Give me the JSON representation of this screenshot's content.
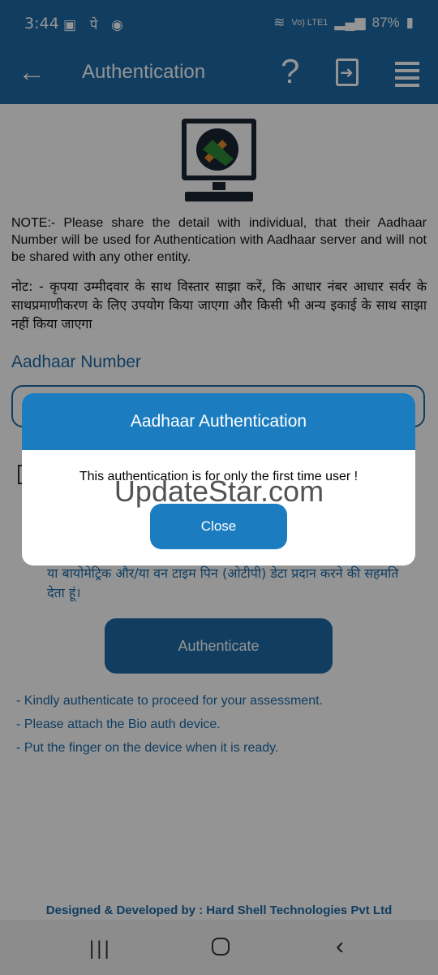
{
  "status_bar": {
    "time": "3:44",
    "left_icons": "▣ पे ◉",
    "network": "Vo) LTE1",
    "battery": "87%"
  },
  "app_bar": {
    "title": "Authentication"
  },
  "note_en": "NOTE:- Please share the detail with individual, that their Aadhaar Number will be used for Authentication with Aadhaar server and will not be shared with any other entity.",
  "note_hi": "नोट: - कृपया उम्मीदवार के साथ विस्तार साझा करें, कि आधार नंबर आधार सर्वर के साथप्रमाणीकरण के लिए उपयोग किया जाएगा और किसी भी अन्य इकाई के साथ साझा नहीं किया जाएगा",
  "aadhaar": {
    "label": "Aadhaar Number",
    "value": ""
  },
  "consent_visible": "या बायोमेट्रिक और/या वन टाइम पिन (ओटीपी) डेटा प्रदान करने की सहमति देता हूं।",
  "authenticate_label": "Authenticate",
  "hints": [
    "- Kindly authenticate to proceed for your assessment.",
    "- Please attach the Bio auth device.",
    "- Put the finger on the device when it is ready."
  ],
  "footer": "Designed & Developed by : Hard Shell Technologies Pvt Ltd",
  "dialog": {
    "title": "Aadhaar Authentication",
    "message": "This authentication is for only the first time user !",
    "close_label": "Close"
  },
  "watermark": "UpdateStar.com",
  "colors": {
    "primary": "#1c6aa6",
    "dialog_header": "#1b7dc0"
  }
}
